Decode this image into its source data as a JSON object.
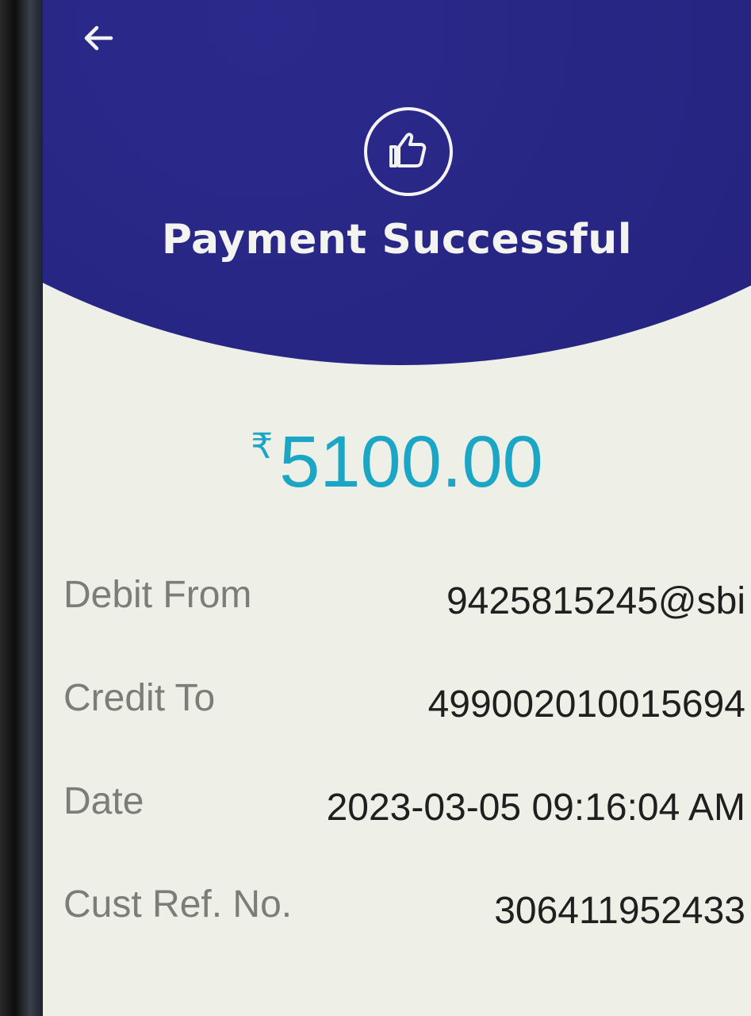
{
  "header": {
    "back_icon": "arrow-left-icon",
    "status_icon": "thumbs-up-icon",
    "title": "Payment Successful",
    "background_color": "#25237e"
  },
  "payment": {
    "currency_symbol": "₹",
    "amount": "5100.00",
    "amount_color": "#1aa6c4"
  },
  "details": {
    "debit_from": {
      "label": "Debit From",
      "value": "9425815245@sbi"
    },
    "credit_to": {
      "label": "Credit To",
      "value": "499002010015694"
    },
    "date": {
      "label": "Date",
      "value": "2023-03-05 09:16:04 AM"
    },
    "cust_ref": {
      "label": "Cust Ref. No.",
      "value": "306411952433"
    }
  }
}
